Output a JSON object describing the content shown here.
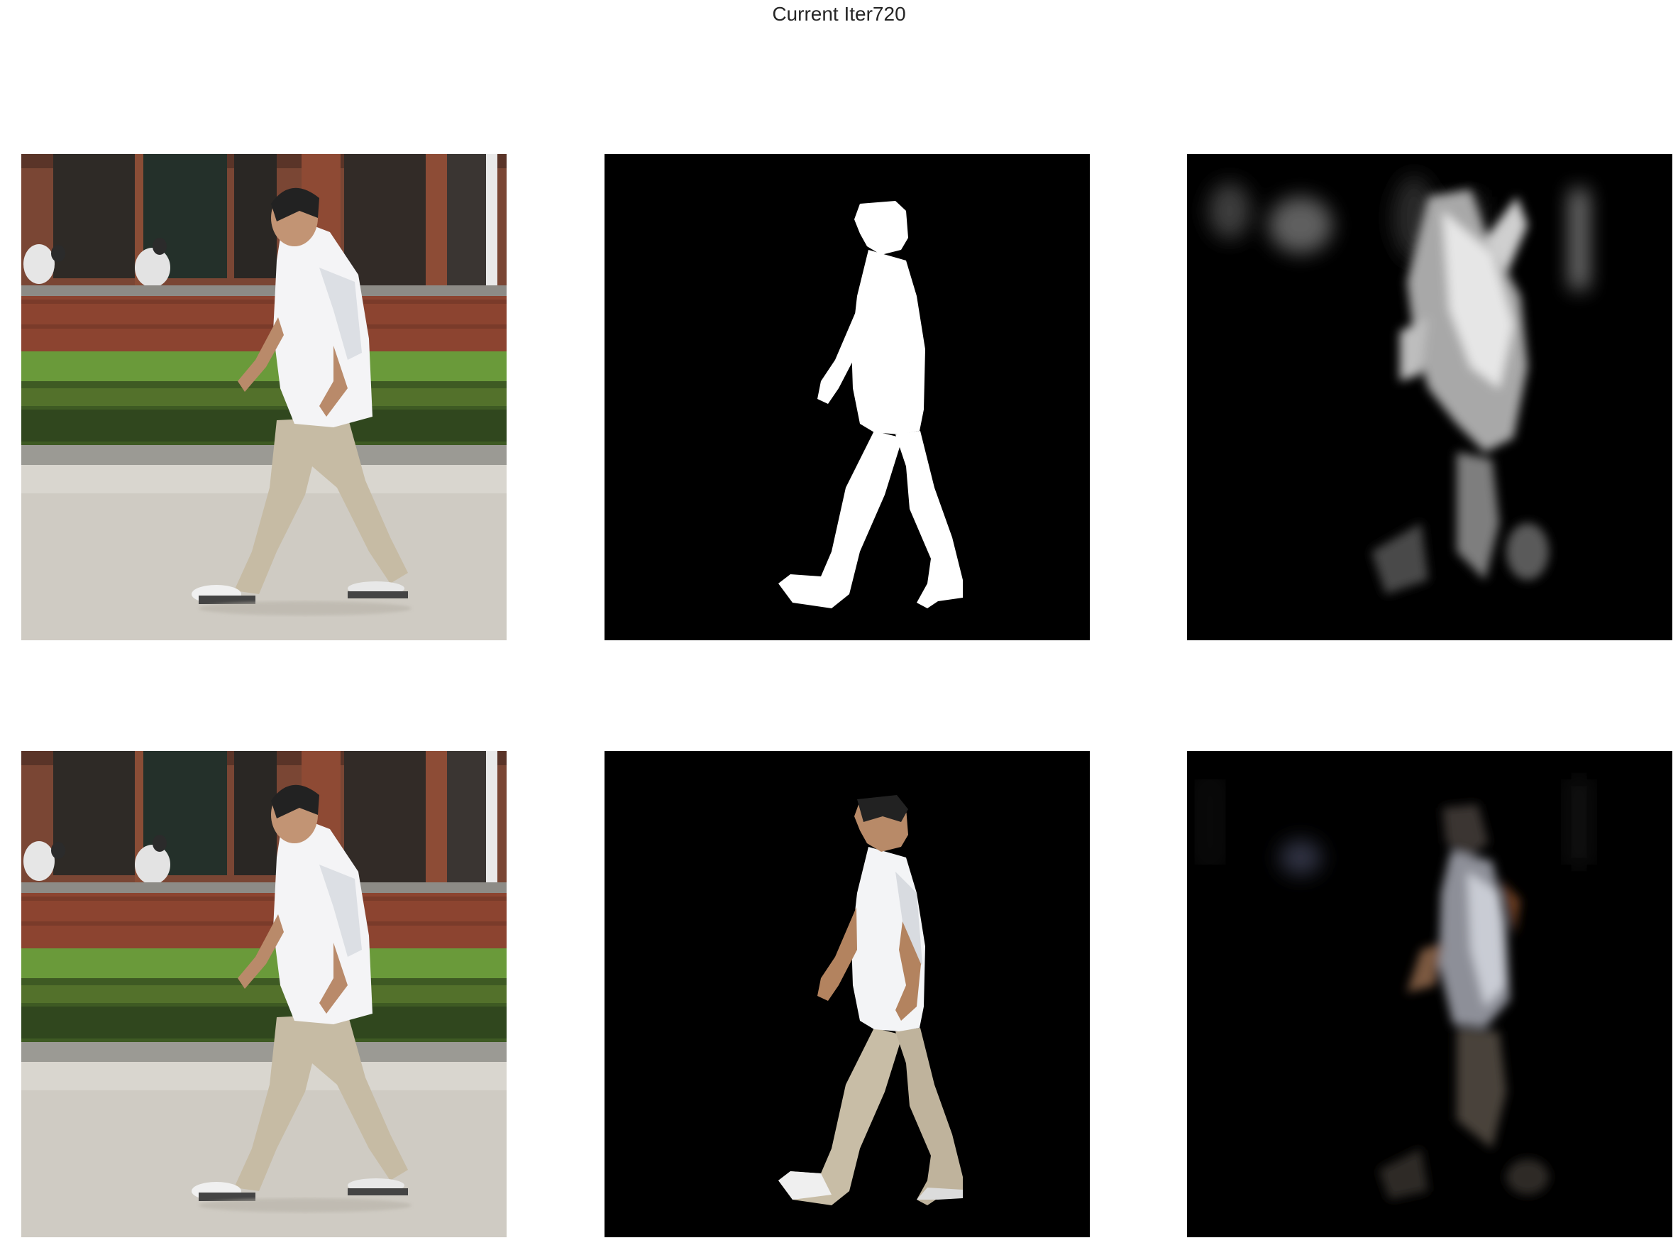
{
  "figure": {
    "title": "Current Iter720"
  },
  "panels": [
    {
      "row": 0,
      "col": 0,
      "content": "input-photo"
    },
    {
      "row": 0,
      "col": 1,
      "content": "ground-truth-mask"
    },
    {
      "row": 0,
      "col": 2,
      "content": "predicted-saliency-map"
    },
    {
      "row": 1,
      "col": 0,
      "content": "input-photo"
    },
    {
      "row": 1,
      "col": 1,
      "content": "masked-foreground"
    },
    {
      "row": 1,
      "col": 2,
      "content": "predicted-foreground"
    }
  ]
}
